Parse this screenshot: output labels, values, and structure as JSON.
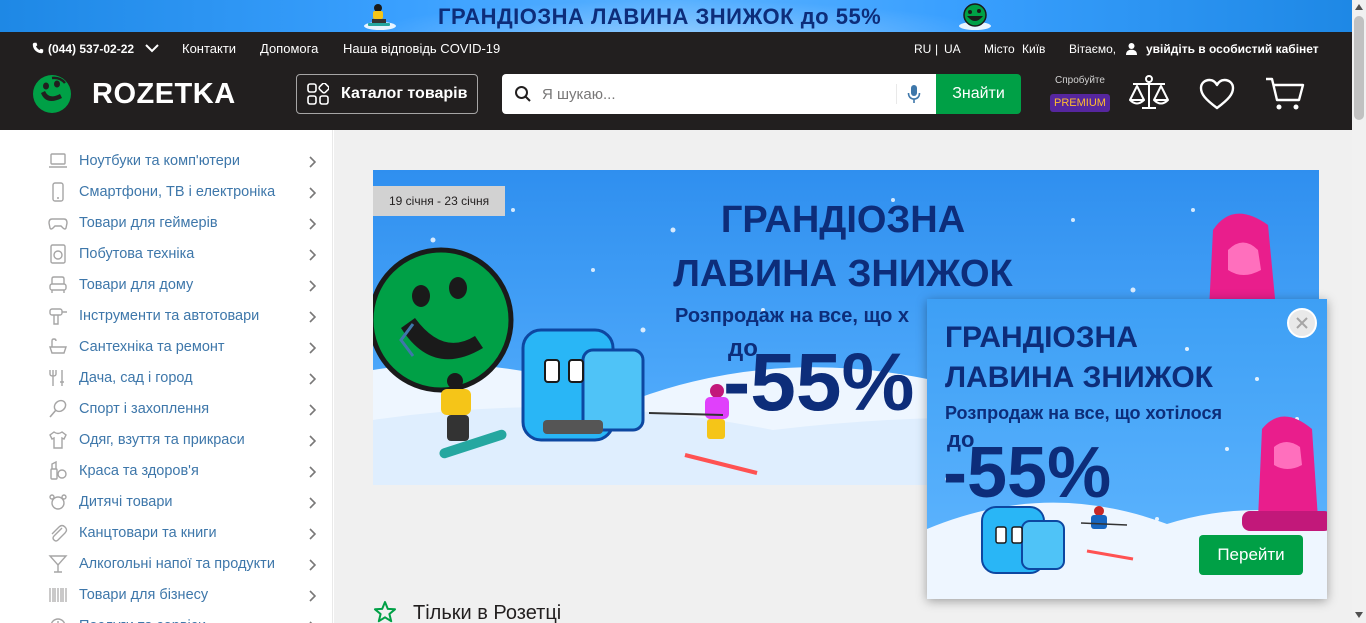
{
  "promo_strip": {
    "text": "ГРАНДІОЗНА ЛАВИНА ЗНИЖОК до 55%"
  },
  "topbar": {
    "phone": "(044) 537-02-22",
    "contacts": "Контакти",
    "help": "Допомога",
    "covid": "Наша відповідь COVID-19",
    "lang_ru": "RU",
    "lang_sep": "|",
    "lang_ua": "UA",
    "city_label": "Місто",
    "city": "Київ",
    "greeting": "Вітаємо,",
    "login": "увійдіть в особистий кабінет"
  },
  "logo": {
    "text": "ROZETKA"
  },
  "catalog_button": {
    "label": "Каталог товарів"
  },
  "search": {
    "placeholder": "Я шукаю...",
    "value": "",
    "button": "Знайти"
  },
  "premium": {
    "try": "Спробуйте",
    "badge": "PREMIUM"
  },
  "header_icons": [
    "scales-icon",
    "heart-icon",
    "cart-icon"
  ],
  "sidebar": {
    "items": [
      {
        "label": "Ноутбуки та комп'ютери",
        "icon": "laptop-icon"
      },
      {
        "label": "Смартфони, ТВ і електроніка",
        "icon": "smartphone-icon"
      },
      {
        "label": "Товари для геймерів",
        "icon": "gamepad-icon"
      },
      {
        "label": "Побутова техніка",
        "icon": "washer-icon"
      },
      {
        "label": "Товари для дому",
        "icon": "armchair-icon"
      },
      {
        "label": "Інструменти та автотовари",
        "icon": "drill-icon"
      },
      {
        "label": "Сантехніка та ремонт",
        "icon": "bathtub-icon"
      },
      {
        "label": "Дача, сад і город",
        "icon": "garden-tools-icon"
      },
      {
        "label": "Спорт і захоплення",
        "icon": "racket-icon"
      },
      {
        "label": "Одяг, взуття та прикраси",
        "icon": "tshirt-icon"
      },
      {
        "label": "Краса та здоров'я",
        "icon": "cosmetics-icon"
      },
      {
        "label": "Дитячі товари",
        "icon": "teddy-bear-icon"
      },
      {
        "label": "Канцтовари та книги",
        "icon": "paperclip-icon"
      },
      {
        "label": "Алкогольні напої та продукти",
        "icon": "cocktail-icon"
      },
      {
        "label": "Товари для бізнесу",
        "icon": "barcode-icon"
      },
      {
        "label": "Послуги та сервіси",
        "icon": "services-icon"
      }
    ]
  },
  "hero": {
    "date_badge": "19 січня - 23 січня",
    "line1": "ГРАНДІОЗНА",
    "line2": "ЛАВИНА ЗНИЖОК",
    "line3": "Розпродаж на все, що х",
    "prefix": "до",
    "discount": "-55%"
  },
  "section": {
    "title": "Тільки в Розетці"
  },
  "popup": {
    "line1": "ГРАНДІОЗНА",
    "line2": "ЛАВИНА ЗНИЖОК",
    "line3": "Розпродаж на все, що хотілося",
    "prefix": "до",
    "discount": "-55%",
    "button": "Перейти"
  },
  "colors": {
    "header_bg": "#221f1f",
    "accent_green": "#00a046",
    "link_blue": "#3e77aa",
    "banner_blue": "#3aa0ff",
    "banner_text": "#0d2d7a",
    "premium_purple": "#56269e"
  }
}
